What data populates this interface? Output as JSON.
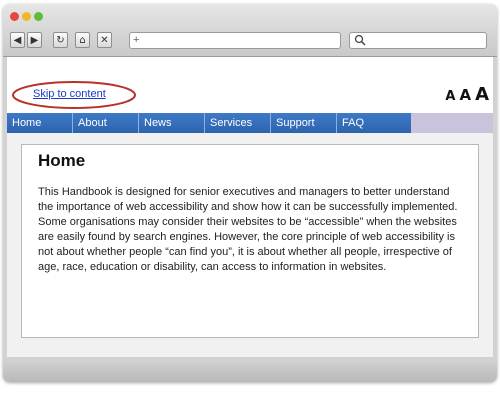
{
  "browser": {
    "tab_new": "+",
    "nav_buttons": [
      "◀",
      "▶",
      "↻",
      "⌂",
      "✕"
    ]
  },
  "page": {
    "skip_link": "Skip to content",
    "text_size": [
      "A",
      "A",
      "A"
    ],
    "menu": [
      "Home",
      "About",
      "News",
      "Services",
      "Support",
      "FAQ"
    ],
    "content": {
      "title": "Home",
      "body": "This Handbook is designed for senior executives and managers to better understand the importance of web accessibility and show how it can be successfully implemented. Some organisations may consider their websites to be “accessible” when the websites are easily found by search engines. However, the core principle of web accessibility is not about whether people “can find you”, it is about whether all people, irrespective of age, race, education or disability, can access to information in websites."
    }
  },
  "colors": {
    "menu_blue": "#2d63ad",
    "menu_lavender": "#c9c3dc",
    "annotation_red": "#b8322c",
    "link_blue": "#1a3cc8"
  }
}
